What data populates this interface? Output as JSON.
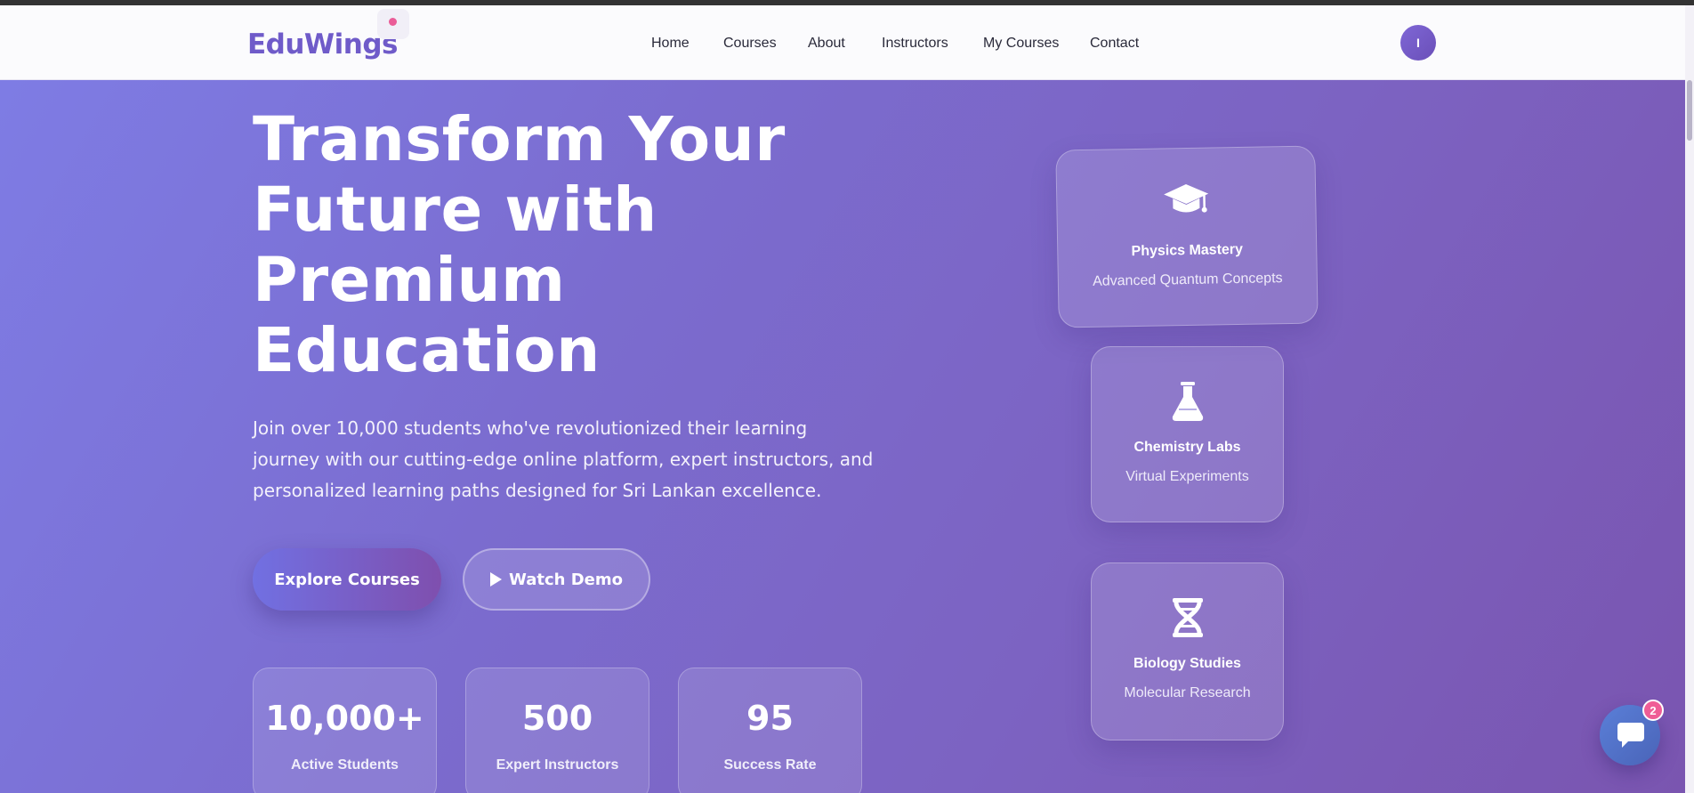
{
  "header": {
    "logo": "EduWings",
    "nav": [
      {
        "label": "Home"
      },
      {
        "label": "Courses"
      },
      {
        "label": "About"
      },
      {
        "label": "Instructors"
      },
      {
        "label": "My Courses"
      },
      {
        "label": "Contact"
      }
    ],
    "avatar_initial": "I"
  },
  "hero": {
    "title_lines": [
      "Transform Your",
      "Future with",
      "Premium",
      "Education"
    ],
    "description": "Join over 10,000 students who've revolutionized their learning journey with our cutting-edge online platform, expert instructors, and personalized learning paths designed for Sri Lankan excellence.",
    "buttons": {
      "explore": "Explore Courses",
      "demo": "Watch Demo"
    },
    "stats": [
      {
        "value": "10,000+",
        "label": "Active Students"
      },
      {
        "value": "500",
        "label": "Expert Instructors"
      },
      {
        "value": "95",
        "label": "Success Rate"
      }
    ]
  },
  "cards": [
    {
      "icon": "graduation-cap-icon",
      "title": "Physics Mastery",
      "subtitle": "Advanced Quantum Concepts"
    },
    {
      "icon": "flask-icon",
      "title": "Chemistry Labs",
      "subtitle": "Virtual Experiments"
    },
    {
      "icon": "dna-icon",
      "title": "Biology Studies",
      "subtitle": "Molecular Research"
    }
  ],
  "chat": {
    "badge_count": "2"
  },
  "colors": {
    "brand": "#6f5bc9",
    "accent": "#ea5c97",
    "hero_start": "#7e7ce4",
    "hero_end": "#7a55b0"
  }
}
